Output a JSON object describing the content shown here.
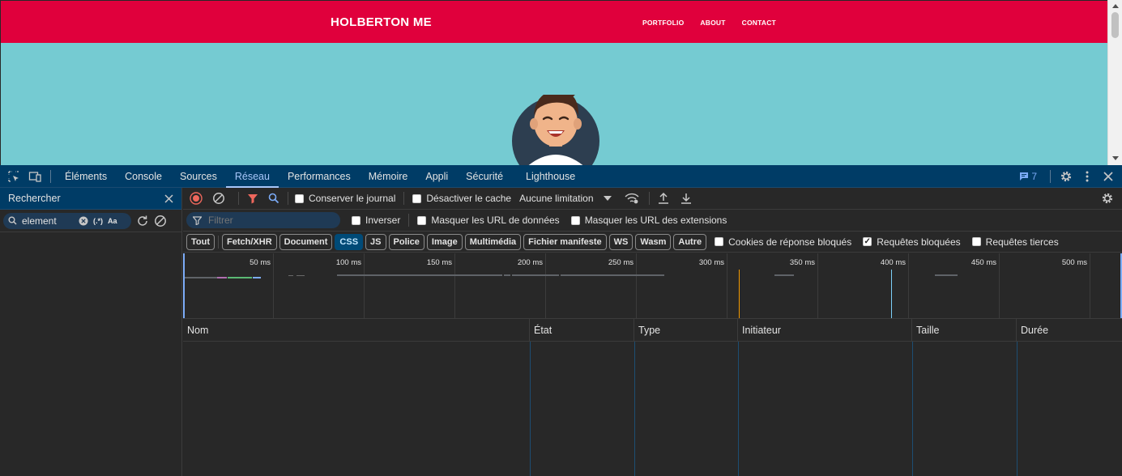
{
  "site": {
    "brand": "HOLBERTON ME",
    "nav": [
      "PORTFOLIO",
      "ABOUT",
      "CONTACT"
    ],
    "colors": {
      "header": "#e0003c",
      "hero": "#75cbd2"
    }
  },
  "devtools": {
    "tabs": [
      "Éléments",
      "Console",
      "Sources",
      "Réseau",
      "Performances",
      "Mémoire",
      "Appli",
      "Sécurité",
      "Lighthouse"
    ],
    "active_tab": "Réseau",
    "issues_count": "7",
    "search": {
      "title": "Rechercher",
      "query": "element",
      "regex_label": "(.*)",
      "case_label": "Aa"
    },
    "network": {
      "preserve_log": "Conserver le journal",
      "disable_cache": "Désactiver le cache",
      "throttling": "Aucune limitation",
      "filter_placeholder": "Filtrer",
      "invert": "Inverser",
      "hide_data_urls": "Masquer les URL de données",
      "hide_ext_urls": "Masquer les URL des extensions",
      "type_filters": [
        "Tout",
        "Fetch/XHR",
        "Document",
        "CSS",
        "JS",
        "Police",
        "Image",
        "Multimédia",
        "Fichier manifeste",
        "WS",
        "Wasm",
        "Autre"
      ],
      "active_filter": "CSS",
      "blocked_cookies": "Cookies de réponse bloqués",
      "blocked_requests": "Requêtes bloquées",
      "blocked_requests_checked": true,
      "third_party": "Requêtes tierces",
      "timeline_ticks": [
        "50 ms",
        "100 ms",
        "150 ms",
        "200 ms",
        "250 ms",
        "300 ms",
        "350 ms",
        "400 ms",
        "450 ms",
        "500 ms"
      ],
      "columns": [
        "Nom",
        "État",
        "Type",
        "Initiateur",
        "Taille",
        "Durée"
      ]
    }
  }
}
